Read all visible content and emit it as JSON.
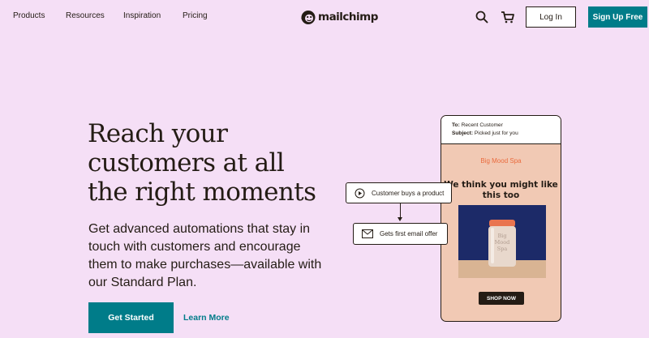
{
  "nav": {
    "items": [
      {
        "label": "Products"
      },
      {
        "label": "Resources"
      },
      {
        "label": "Inspiration"
      },
      {
        "label": "Pricing"
      }
    ],
    "brand": "mailchimp",
    "login_label": "Log In",
    "signup_label": "Sign Up Free",
    "icons": [
      "search-icon",
      "cart-icon"
    ]
  },
  "hero": {
    "headline": "Reach your customers at all the right moments",
    "subtext": "Get advanced automations that stay in touch with customers and encourage them to make purchases—available with our Standard Plan.",
    "primary_cta": "Get Started",
    "secondary_cta": "Learn More"
  },
  "email_preview": {
    "to_label": "To:",
    "to_value": "Recent Customer",
    "subject_label": "Subject:",
    "subject_value": "Picked just for you",
    "brand": "Big Mood Spa",
    "headline": "We think you might like this too",
    "jar_text": "Big Mood Spa",
    "button": "SHOP NOW"
  },
  "flow": {
    "step1": "Customer buys a product",
    "step2": "Gets first email offer"
  },
  "colors": {
    "background": "#f5dff6",
    "accent": "#007c89",
    "text": "#241c15",
    "email_bg": "#f1c9b4",
    "brand_orange": "#ea6b3e"
  }
}
